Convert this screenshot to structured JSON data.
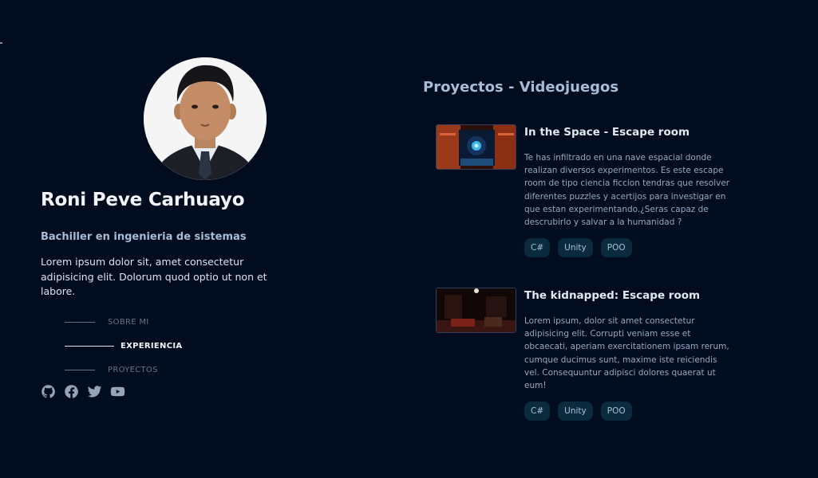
{
  "profile": {
    "name": "Roni Peve Carhuayo",
    "role": "Bachiller en ingenieria de sistemas",
    "bio": "Lorem ipsum dolor sit, amet consectetur adipisicing elit. Dolorum quod optio ut non et labore."
  },
  "nav": [
    {
      "label": "SOBRE MI",
      "active": false
    },
    {
      "label": "EXPERIENCIA",
      "active": true
    },
    {
      "label": "PROYECTOS",
      "active": false
    }
  ],
  "socials": [
    "github-icon",
    "facebook-icon",
    "twitter-icon",
    "youtube-icon"
  ],
  "projects_section": {
    "title": "Proyectos - Videojuegos",
    "items": [
      {
        "title": "In the Space - Escape room",
        "description": "Te has infiltrado en una nave espacial donde realizan diversos experimentos. Es este escape room de tipo ciencia ficcion tendras que resolver diferentes puzzles y acertijos para investigar en que estan experimentando.¿Seras capaz de descrubirlo y salvar a la humanidad ?",
        "tags": [
          "C#",
          "Unity",
          "POO"
        ]
      },
      {
        "title": "The kidnapped: Escape room",
        "description": "Lorem ipsum, dolor sit amet consectetur adipisicing elit. Corrupti veniam esse et obcaecati, aperiam exercitationem ipsam rerum, cumque ducimus sunt, maxime iste reiciendis vel. Consequuntur adipisci dolores quaerat ut eum!",
        "tags": [
          "C#",
          "Unity",
          "POO"
        ]
      }
    ]
  },
  "colors": {
    "background": "#020c1f",
    "accent": "#a7bcd6",
    "tag_bg": "#0a2b3d"
  }
}
